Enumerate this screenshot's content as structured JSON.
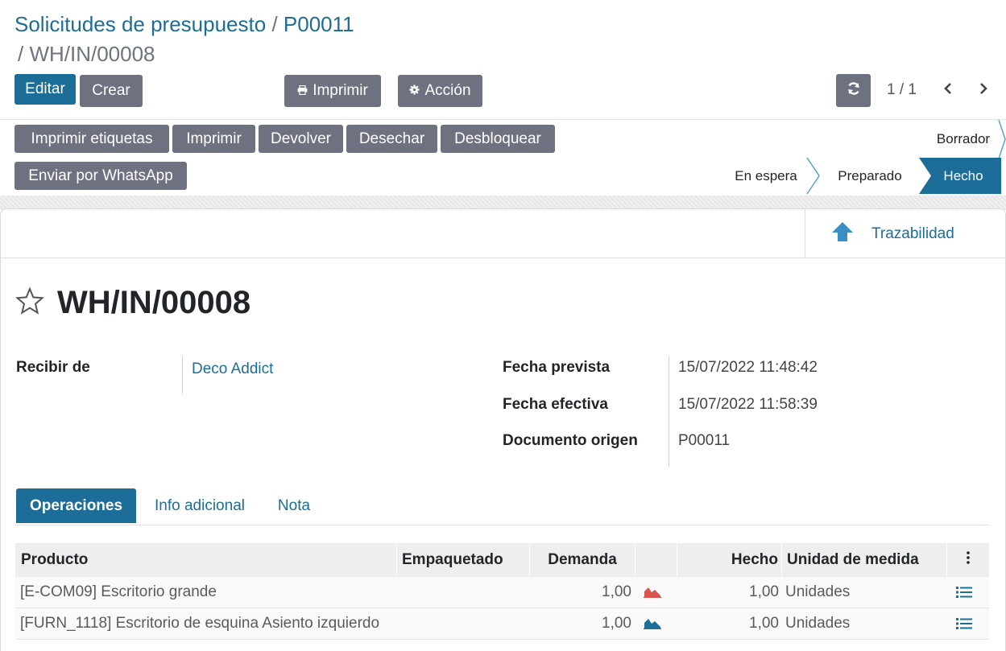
{
  "breadcrumb": {
    "parent": "Solicitudes de presupuesto",
    "separator": "/",
    "order": "P00011",
    "current": "/ WH/IN/00008"
  },
  "control_panel": {
    "edit_label": "Editar",
    "create_label": "Crear",
    "print_label": "Imprimir",
    "action_label": "Acción",
    "pager_value": "1 / 1"
  },
  "statusbar": {
    "buttons": [
      "Imprimir etiquetas",
      "Imprimir",
      "Devolver",
      "Desechar",
      "Desbloquear",
      "Enviar por WhatsApp"
    ],
    "stages": [
      "Borrador",
      "En espera",
      "Preparado",
      "Hecho"
    ],
    "active_stage": "Hecho"
  },
  "smart_buttons": {
    "traceability_label": "Trazabilidad"
  },
  "record": {
    "name": "WH/IN/00008",
    "fields": {
      "receive_from_label": "Recibir de",
      "receive_from_value": "Deco Addict",
      "scheduled_date_label": "Fecha prevista",
      "scheduled_date_value": "15/07/2022 11:48:42",
      "effective_date_label": "Fecha efectiva",
      "effective_date_value": "15/07/2022 11:58:39",
      "origin_label": "Documento origen",
      "origin_value": "P00011"
    }
  },
  "tabs": [
    "Operaciones",
    "Info adicional",
    "Nota"
  ],
  "operations_table": {
    "headers": [
      "Producto",
      "Empaquetado",
      "Demanda",
      "",
      "Hecho",
      "Unidad de medida"
    ],
    "rows": [
      {
        "product": "[E-COM09] Escritorio grande",
        "packaging": "",
        "demand": "1,00",
        "forecast_color": "#d9534f",
        "done": "1,00",
        "uom": "Unidades"
      },
      {
        "product": "[FURN_1118] Escritorio de esquina Asiento izquierdo",
        "packaging": "",
        "demand": "1,00",
        "forecast_color": "#1c6d97",
        "done": "1,00",
        "uom": "Unidades"
      }
    ]
  },
  "colors": {
    "primary": "#1c6d97",
    "secondary": "#6e7180"
  }
}
